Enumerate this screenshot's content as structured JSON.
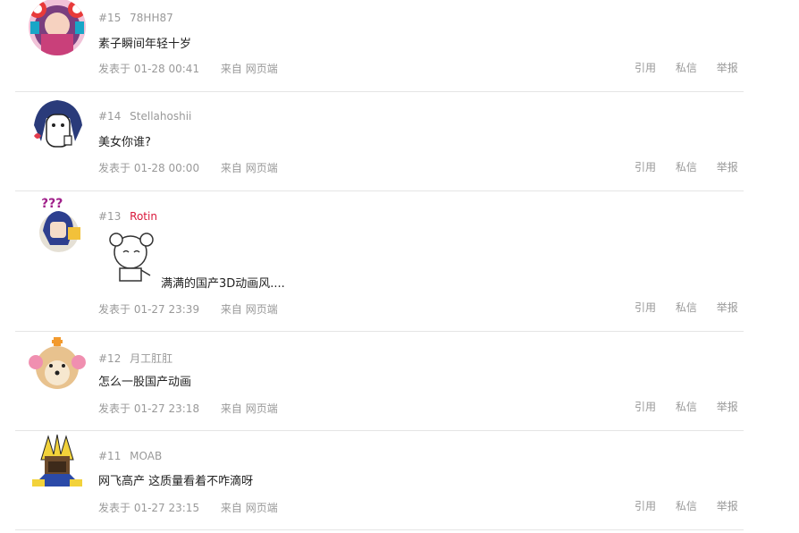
{
  "comments": [
    {
      "floor": "#15",
      "user": "78HH87",
      "text": "素子瞬间年轻十岁",
      "time": "发表于 01-28 00:41",
      "source": "来自 网页端"
    },
    {
      "floor": "#14",
      "user": "Stellahoshii",
      "text": "美女你谁?",
      "time": "发表于 01-28 00:00",
      "source": "来自 网页端"
    },
    {
      "floor": "#13",
      "user": "Rotin",
      "text": "满满的国产3D动画风....",
      "time": "发表于 01-27 23:39",
      "source": "来自 网页端"
    },
    {
      "floor": "#12",
      "user": "月工肛肛",
      "text": "怎么一股国产动画",
      "time": "发表于 01-27 23:18",
      "source": "来自 网页端"
    },
    {
      "floor": "#11",
      "user": "MOAB",
      "text": "网飞高产 这质量看着不咋滴呀",
      "time": "发表于 01-27 23:15",
      "source": "来自 网页端"
    }
  ],
  "actions": {
    "quote": "引用",
    "message": "私信",
    "report": "举报"
  },
  "colors": {
    "meta": "#999999",
    "highlight_user": "#d9183b",
    "divider": "#e5e5e5"
  }
}
